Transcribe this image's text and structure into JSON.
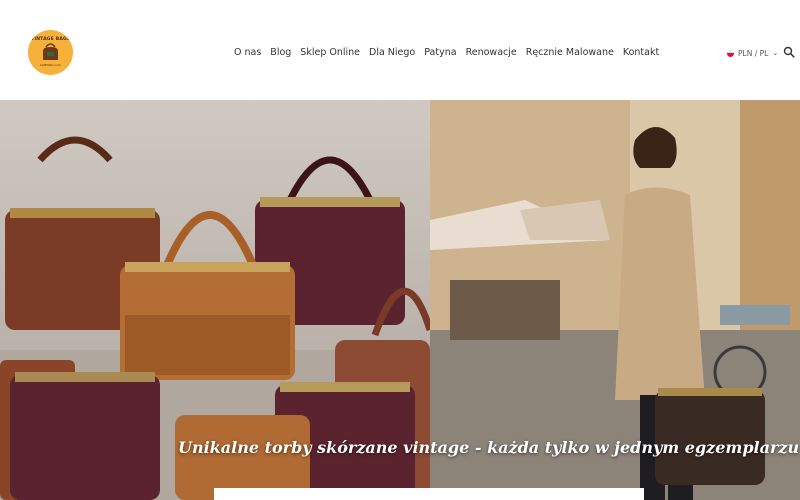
{
  "logo": {
    "text": "VINTAGE BAGS",
    "sub": "kaMIKOO.com"
  },
  "nav": {
    "items": [
      "O nas",
      "Blog",
      "Sklep Online",
      "Dla Niego",
      "Patyna",
      "Renowacje",
      "Ręcznie Malowane",
      "Kontakt"
    ]
  },
  "lang": {
    "label": "PLN / PL",
    "flag_colors": [
      "#ffffff",
      "#dc143c"
    ]
  },
  "hero": {
    "caption": "Unikalne torby skórzane vintage - każda tylko w jednym egzemplarzu"
  },
  "icons": {
    "search": "search-icon",
    "chevron": "chevron-down-icon"
  }
}
